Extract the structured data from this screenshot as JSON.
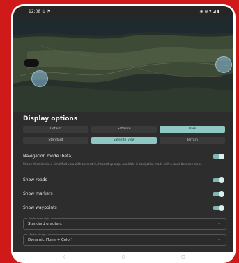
{
  "status_bar": {
    "time": "12:08 ⚙ ⚑",
    "icons": "◈ ⊕ ▾ ◢ ▮"
  },
  "panel": {
    "title": "Display options",
    "map_type_segments": [
      {
        "label": "Default",
        "active": false
      },
      {
        "label": "Satellite",
        "active": false
      },
      {
        "label": "Dark",
        "active": true
      }
    ],
    "view_segments": [
      {
        "label": "Standard",
        "active": false
      },
      {
        "label": "Satellite view",
        "active": true
      },
      {
        "label": "Terrain",
        "active": false
      }
    ],
    "navigation_mode": {
      "label": "Navigation mode (beta)",
      "helper": "Shows directions in a simplified view with zoomed-in, headed-up map. Available in navigation mode with a route between stops."
    },
    "toggles": [
      {
        "label": "Show roads",
        "on": true
      },
      {
        "label": "Show markers",
        "on": true
      },
      {
        "label": "Show waypoints",
        "on": true
      }
    ],
    "fields": [
      {
        "label": "Route color style",
        "value": "Standard gradient"
      },
      {
        "label": "Marker design",
        "value": "Dynamic (Tone + Color)"
      }
    ]
  },
  "navbar": {
    "back": "◁",
    "home": "○",
    "recents": "▢"
  },
  "colors": {
    "frame": "#d01a1a",
    "panel": "#2d2d2d",
    "accent": "#8fc7c2"
  }
}
